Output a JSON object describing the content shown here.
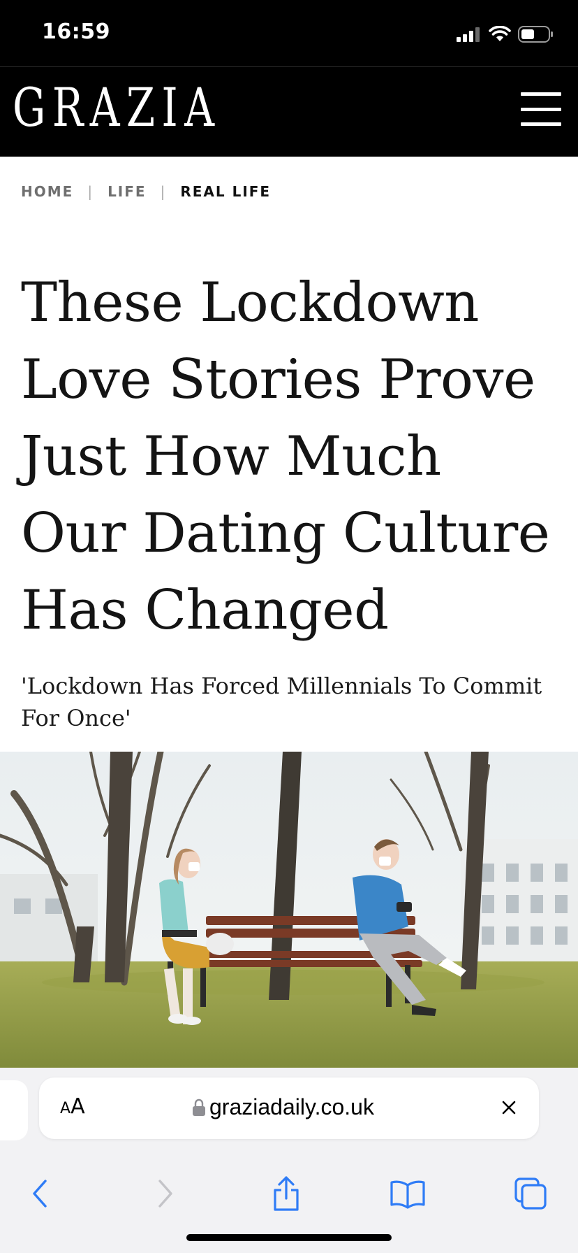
{
  "status_bar": {
    "time": "16:59",
    "icons": [
      "cellular-signal-icon",
      "wifi-icon",
      "battery-icon"
    ]
  },
  "header": {
    "logo": "GRAZIA",
    "menu_icon": "hamburger-menu-icon"
  },
  "breadcrumb": {
    "items": [
      "HOME",
      "LIFE",
      "REAL LIFE"
    ],
    "separator": "|"
  },
  "article": {
    "headline_lines": [
      "These Lockdown",
      "Love Stories Prove",
      "Just How Much",
      "Our Dating Culture",
      "Has Changed"
    ],
    "standfirst_lines": [
      "'Lockdown Has Forced Millennials To Commit",
      "For Once'"
    ]
  },
  "browser": {
    "text_size_small": "A",
    "text_size_large": "A",
    "url": "graziadaily.co.uk",
    "toolbar_icons": [
      "back-icon",
      "forward-icon",
      "share-icon",
      "bookmarks-icon",
      "tabs-icon"
    ]
  },
  "colors": {
    "header_bg": "#000000",
    "accent_blue": "#2f7cf6",
    "disabled_grey": "#c4c4c8",
    "browser_bg": "#f2f2f4"
  }
}
